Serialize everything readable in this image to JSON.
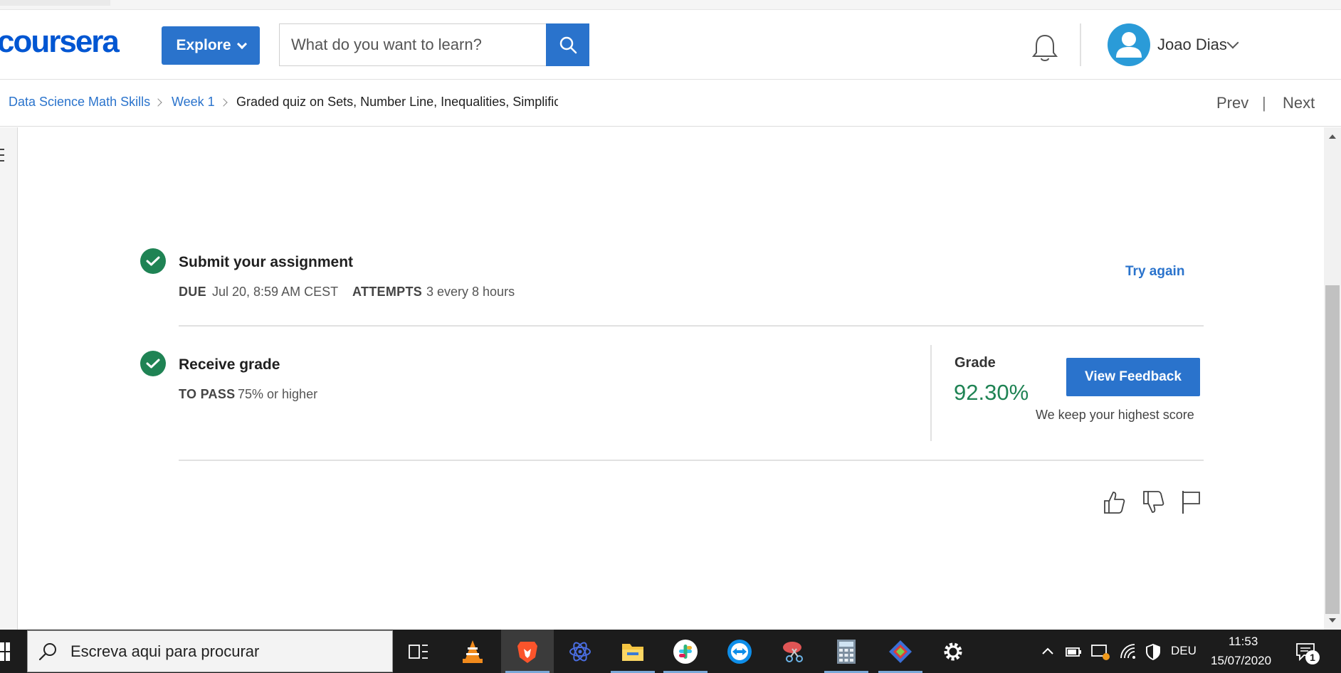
{
  "header": {
    "logo_text": "coursera",
    "explore_label": "Explore",
    "search_placeholder": "What do you want to learn?",
    "user_name": "Joao Dias"
  },
  "breadcrumb": {
    "items": [
      "Data Science Math Skills",
      "Week 1"
    ],
    "current": "Graded quiz on Sets, Number Line, Inequalities, Simplific",
    "prev_label": "Prev",
    "next_label": "Next",
    "separator": "|"
  },
  "submit": {
    "title": "Submit your assignment",
    "due_key": "DUE",
    "due_value": "Jul 20, 8:59 AM CEST",
    "attempts_key": "ATTEMPTS",
    "attempts_value": "3 every 8 hours",
    "try_again_label": "Try again"
  },
  "grade": {
    "title": "Receive grade",
    "pass_key": "TO PASS",
    "pass_value": "75% or higher",
    "label": "Grade",
    "value": "92.30%",
    "feedback_label": "View Feedback",
    "keep_note": "We keep your highest score"
  },
  "taskbar": {
    "search_text": "Escreva aqui para procurar",
    "language": "DEU",
    "time": "11:53",
    "date": "15/07/2020",
    "notification_count": "1"
  },
  "colors": {
    "brand_blue": "#2a73cc",
    "success_green": "#1f8354"
  }
}
